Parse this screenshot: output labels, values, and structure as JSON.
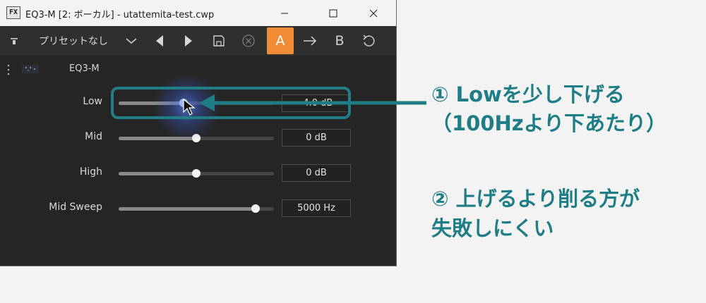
{
  "window": {
    "fx_badge": "FX",
    "title": "EQ3-M [2: ボーカル] - utattemita-test.cwp"
  },
  "toolbar": {
    "preset": "プリセットなし",
    "btn_a": "A",
    "btn_b": "B"
  },
  "plugin": {
    "name": "EQ3-M"
  },
  "params": [
    {
      "label": "Low",
      "value": "-4.0 dB",
      "level": 0.42
    },
    {
      "label": "Mid",
      "value": "0 dB",
      "level": 0.5
    },
    {
      "label": "High",
      "value": "0 dB",
      "level": 0.5
    },
    {
      "label": "Mid Sweep",
      "value": "5000 Hz",
      "level": 0.88
    }
  ],
  "annotations": {
    "line1": "① Lowを少し下げる",
    "line2": "（100Hzより下あたり）",
    "line3": "② 上げるより削る方が",
    "line4": "失敗しにくい"
  },
  "colors": {
    "accent": "#f08c35",
    "annotation": "#1f7d86"
  }
}
